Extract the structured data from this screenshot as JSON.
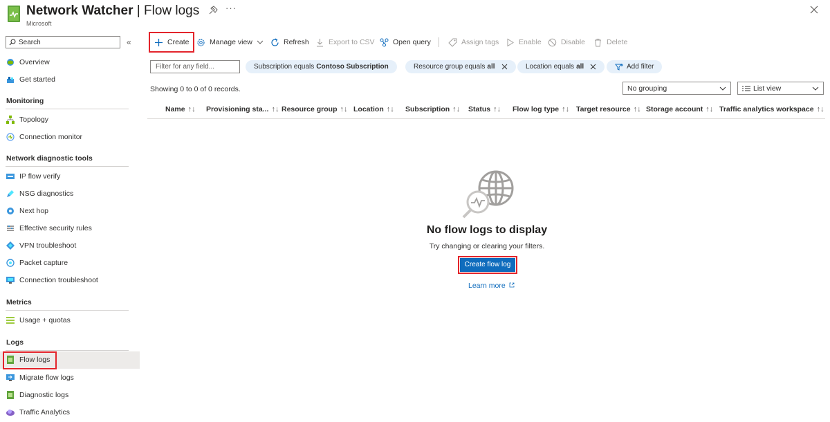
{
  "header": {
    "service": "Network Watcher",
    "separator": "|",
    "pane": "Flow logs",
    "publisher": "Microsoft",
    "more": "···"
  },
  "sidebar": {
    "search_placeholder": "Search",
    "collapse_glyph": "«",
    "overview": "Overview",
    "get_started": "Get started",
    "monitoring_header": "Monitoring",
    "topology": "Topology",
    "connection_monitor": "Connection monitor",
    "diagnostics_header": "Network diagnostic tools",
    "ip_flow_verify": "IP flow verify",
    "nsg_diagnostics": "NSG diagnostics",
    "next_hop": "Next hop",
    "effective_security_rules": "Effective security rules",
    "vpn_troubleshoot": "VPN troubleshoot",
    "packet_capture": "Packet capture",
    "connection_troubleshoot": "Connection troubleshoot",
    "metrics_header": "Metrics",
    "usage_quotas": "Usage + quotas",
    "logs_header": "Logs",
    "flow_logs": "Flow logs",
    "migrate_flow_logs": "Migrate flow logs",
    "diagnostic_logs": "Diagnostic logs",
    "traffic_analytics": "Traffic Analytics"
  },
  "toolbar": {
    "create": "Create",
    "manage_view": "Manage view",
    "refresh": "Refresh",
    "export_csv": "Export to CSV",
    "open_query": "Open query",
    "assign_tags": "Assign tags",
    "enable": "Enable",
    "disable": "Disable",
    "delete": "Delete"
  },
  "filters": {
    "search_placeholder": "Filter for any field...",
    "subscription_prefix": "Subscription equals",
    "subscription_value": "Contoso Subscription",
    "resource_group_prefix": "Resource group equals",
    "resource_group_value": "all",
    "location_prefix": "Location equals",
    "location_value": "all",
    "add_filter": "Add filter"
  },
  "list": {
    "records": "Showing 0 to 0 of 0 records.",
    "grouping": "No grouping",
    "view": "List view",
    "sort_glyph": "↑↓",
    "sort_glyph_name": "↑↓",
    "columns": {
      "name": "Name",
      "provisioning": "Provisioning sta...",
      "resource_group": "Resource group",
      "location": "Location",
      "subscription": "Subscription",
      "status": "Status",
      "flow_log_type": "Flow log type",
      "target_resource": "Target resource",
      "storage_account": "Storage account",
      "traffic_workspace": "Traffic analytics workspace"
    }
  },
  "empty": {
    "title": "No flow logs to display",
    "subtitle": "Try changing or clearing your filters.",
    "cta": "Create flow log",
    "learn_more": "Learn more"
  },
  "colors": {
    "accent": "#0f6cbd",
    "highlight": "#e3242b",
    "pill": "#e6f0fa"
  }
}
